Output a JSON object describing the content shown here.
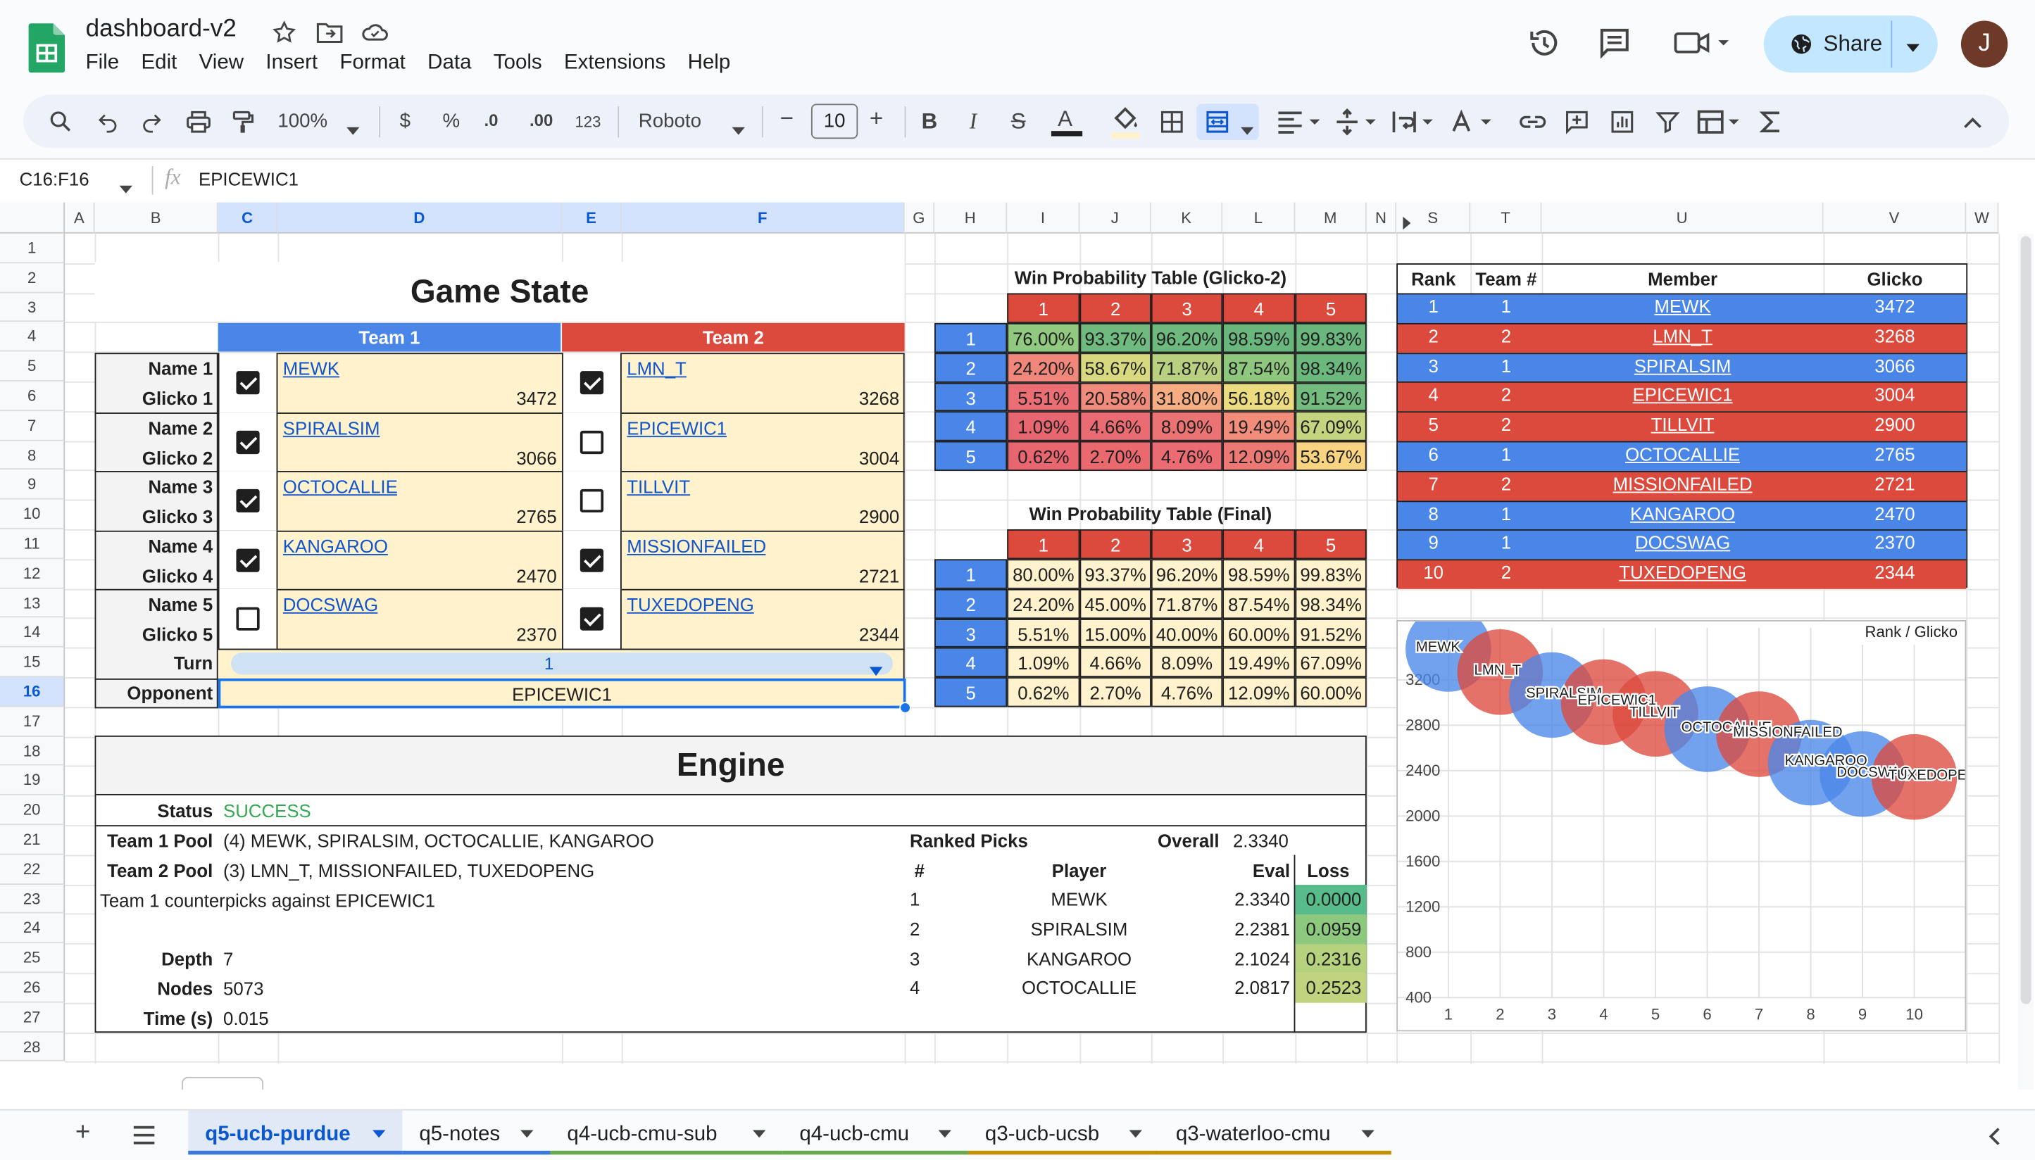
{
  "app": {
    "doc_title": "dashboard-v2",
    "menus": [
      "File",
      "Edit",
      "View",
      "Insert",
      "Format",
      "Data",
      "Tools",
      "Extensions",
      "Help"
    ],
    "share_label": "Share",
    "avatar_letter": "J"
  },
  "toolbar": {
    "zoom": "100%",
    "currency": "$",
    "percent": "%",
    "dec_less": ".0",
    "dec_more": ".00",
    "number_format": "123",
    "font": "Roboto",
    "font_size": "10",
    "minus": "−",
    "plus": "+",
    "bold": "B",
    "italic": "I",
    "strike": "S",
    "text_color": "A"
  },
  "formula_bar": {
    "name_box": "C16:F16",
    "content": "EPICEWIC1"
  },
  "columns": [
    "A",
    "B",
    "C",
    "D",
    "E",
    "F",
    "G",
    "H",
    "I",
    "J",
    "K",
    "L",
    "M",
    "N",
    "S",
    "T",
    "U",
    "V",
    "W"
  ],
  "rows": [
    "1",
    "2",
    "3",
    "4",
    "5",
    "6",
    "7",
    "8",
    "9",
    "10",
    "11",
    "12",
    "13",
    "14",
    "15",
    "16",
    "17",
    "18",
    "19",
    "20",
    "21",
    "22",
    "23",
    "24",
    "25",
    "26",
    "27",
    "28"
  ],
  "game_state": {
    "title": "Game State",
    "team1_header": "Team 1",
    "team2_header": "Team 2",
    "players": [
      {
        "name_label": "Name 1",
        "glicko_label": "Glicko 1",
        "t1_checked": true,
        "t1_name": "MEWK",
        "t1_glicko": "3472",
        "t2_checked": true,
        "t2_name": "LMN_T",
        "t2_glicko": "3268"
      },
      {
        "name_label": "Name 2",
        "glicko_label": "Glicko 2",
        "t1_checked": true,
        "t1_name": "SPIRALSIM",
        "t1_glicko": "3066",
        "t2_checked": false,
        "t2_name": "EPICEWIC1",
        "t2_glicko": "3004"
      },
      {
        "name_label": "Name 3",
        "glicko_label": "Glicko 3",
        "t1_checked": true,
        "t1_name": "OCTOCALLIE",
        "t1_glicko": "2765",
        "t2_checked": false,
        "t2_name": "TILLVIT",
        "t2_glicko": "2900"
      },
      {
        "name_label": "Name 4",
        "glicko_label": "Glicko 4",
        "t1_checked": true,
        "t1_name": "KANGAROO",
        "t1_glicko": "2470",
        "t2_checked": true,
        "t2_name": "MISSIONFAILED",
        "t2_glicko": "2721"
      },
      {
        "name_label": "Name 5",
        "glicko_label": "Glicko 5",
        "t1_checked": false,
        "t1_name": "DOCSWAG",
        "t1_glicko": "2370",
        "t2_checked": true,
        "t2_name": "TUXEDOPENG",
        "t2_glicko": "2344"
      }
    ],
    "turn_label": "Turn",
    "turn_value": "1",
    "opponent_label": "Opponent",
    "opponent_value": "EPICEWIC1"
  },
  "wp_glicko": {
    "title": "Win Probability Table (Glicko-2)",
    "headers": [
      "1",
      "2",
      "3",
      "4",
      "5"
    ],
    "rows": [
      [
        "1",
        "76.00%",
        "93.37%",
        "96.20%",
        "98.59%",
        "99.83%"
      ],
      [
        "2",
        "24.20%",
        "58.67%",
        "71.87%",
        "87.54%",
        "98.34%"
      ],
      [
        "3",
        "5.51%",
        "20.58%",
        "31.80%",
        "56.18%",
        "91.52%"
      ],
      [
        "4",
        "1.09%",
        "4.66%",
        "8.09%",
        "19.49%",
        "67.09%"
      ],
      [
        "5",
        "0.62%",
        "2.70%",
        "4.76%",
        "12.09%",
        "53.67%"
      ]
    ],
    "colors": [
      [
        "#90c97f",
        "#6fba7e",
        "#6db97e",
        "#6ab77d",
        "#69b77d"
      ],
      [
        "#f0877a",
        "#d8d87e",
        "#b8d07f",
        "#8ec77e",
        "#6bb87d"
      ],
      [
        "#ea6e73",
        "#f08a7a",
        "#f7ad82",
        "#ecdc81",
        "#73bb7e"
      ],
      [
        "#e8666f",
        "#ea6c72",
        "#eb7373",
        "#f18d7a",
        "#c5d47f"
      ],
      [
        "#e8666f",
        "#e9696f",
        "#ea6c72",
        "#ec7974",
        "#f8d381"
      ]
    ]
  },
  "wp_final": {
    "title": "Win Probability Table (Final)",
    "headers": [
      "1",
      "2",
      "3",
      "4",
      "5"
    ],
    "rows": [
      [
        "1",
        "80.00%",
        "93.37%",
        "96.20%",
        "98.59%",
        "99.83%"
      ],
      [
        "2",
        "24.20%",
        "45.00%",
        "71.87%",
        "87.54%",
        "98.34%"
      ],
      [
        "3",
        "5.51%",
        "15.00%",
        "40.00%",
        "60.00%",
        "91.52%"
      ],
      [
        "4",
        "1.09%",
        "4.66%",
        "8.09%",
        "19.49%",
        "67.09%"
      ],
      [
        "5",
        "0.62%",
        "2.70%",
        "4.76%",
        "12.09%",
        "60.00%"
      ]
    ]
  },
  "rank_table": {
    "headers": [
      "Rank",
      "Team #",
      "Member",
      "Glicko"
    ],
    "rows": [
      [
        "1",
        "1",
        "MEWK",
        "3472"
      ],
      [
        "2",
        "2",
        "LMN_T",
        "3268"
      ],
      [
        "3",
        "1",
        "SPIRALSIM",
        "3066"
      ],
      [
        "4",
        "2",
        "EPICEWIC1",
        "3004"
      ],
      [
        "5",
        "2",
        "TILLVIT",
        "2900"
      ],
      [
        "6",
        "1",
        "OCTOCALLIE",
        "2765"
      ],
      [
        "7",
        "2",
        "MISSIONFAILED",
        "2721"
      ],
      [
        "8",
        "1",
        "KANGAROO",
        "2470"
      ],
      [
        "9",
        "1",
        "DOCSWAG",
        "2370"
      ],
      [
        "10",
        "2",
        "TUXEDOPENG",
        "2344"
      ]
    ],
    "team_colors": {
      "1": "#4a86e8",
      "2": "#dc4a3d"
    }
  },
  "engine": {
    "title": "Engine",
    "status_label": "Status",
    "status_value": "SUCCESS",
    "status_color": "#34a853",
    "team1_pool_label": "Team 1 Pool",
    "team1_pool": "(4) MEWK, SPIRALSIM, OCTOCALLIE, KANGAROO",
    "team2_pool_label": "Team 2 Pool",
    "team2_pool": "(3) LMN_T, MISSIONFAILED, TUXEDOPENG",
    "counterpicks": "Team 1 counterpicks against EPICEWIC1",
    "depth_label": "Depth",
    "depth": "7",
    "nodes_label": "Nodes",
    "nodes": "5073",
    "time_label": "Time (s)",
    "time": "0.015",
    "ranked_picks_label": "Ranked Picks",
    "overall_label": "Overall",
    "overall": "2.3340",
    "pick_headers": [
      "#",
      "Player",
      "Eval",
      "Loss"
    ],
    "picks": [
      [
        "1",
        "MEWK",
        "2.3340",
        "0.0000"
      ],
      [
        "2",
        "SPIRALSIM",
        "2.2381",
        "0.0959"
      ],
      [
        "3",
        "KANGAROO",
        "2.1024",
        "0.2316"
      ],
      [
        "4",
        "OCTOCALLIE",
        "2.0817",
        "0.2523"
      ]
    ],
    "loss_colors": [
      "#57bb8a",
      "#8dc87f",
      "#b6d27f",
      "#c0d47f"
    ]
  },
  "chart_data": {
    "type": "scatter",
    "title": "Rank / Glicko",
    "x": [
      1,
      2,
      3,
      4,
      5,
      6,
      7,
      8,
      9,
      10
    ],
    "y": [
      3472,
      3268,
      3066,
      3004,
      2900,
      2765,
      2721,
      2470,
      2370,
      2344
    ],
    "labels": [
      "MEWK",
      "LMN_T",
      "SPIRALSIM",
      "EPICEWIC1",
      "TILLVIT",
      "OCTOCALLIE",
      "MISSIONFAILED",
      "KANGAROO",
      "DOCSWAG",
      "TUXEDOPENG"
    ],
    "team": [
      1,
      2,
      1,
      2,
      2,
      1,
      2,
      1,
      1,
      2
    ],
    "xlim": [
      1,
      10
    ],
    "ylim": [
      400,
      3200
    ],
    "yticks": [
      "3200",
      "2800",
      "2400",
      "2000",
      "1600",
      "1200",
      "800",
      "400"
    ],
    "xticks": [
      "1",
      "2",
      "3",
      "4",
      "5",
      "6",
      "7",
      "8",
      "9",
      "10"
    ],
    "grid": true
  },
  "sheets": {
    "tabs": [
      "q5-ucb-purdue",
      "q5-notes",
      "q4-ucb-cmu-sub",
      "q4-ucb-cmu",
      "q3-ucb-ucsb",
      "q3-waterloo-cmu"
    ],
    "tab_colors": [
      "#3c78d8",
      "#3c78d8",
      "#6aa84f",
      "#6aa84f",
      "#bf9000",
      "#bf9000"
    ],
    "active": "q5-ucb-purdue"
  }
}
